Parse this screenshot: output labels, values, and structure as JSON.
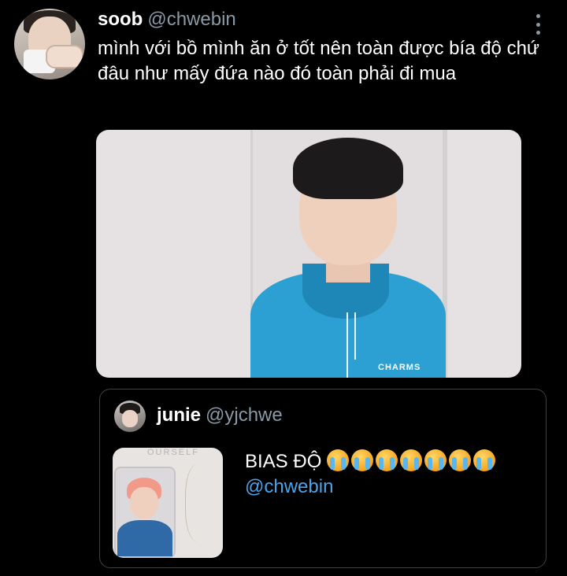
{
  "tweet": {
    "author_name": "soob",
    "author_handle": "@chwebin",
    "text": "mình với bồ mình ăn ở tốt nên toàn được bía độ chứ đâu như mấy đứa nào đó toàn phải đi mua",
    "photo_tag": "CHARMS"
  },
  "quote": {
    "author_name": "junie",
    "author_handle": "@yjchwe",
    "text": "BIAS ĐỘ",
    "emoji_count": 7,
    "emoji_name": "loudly-crying-face-emoji",
    "mention": "@chwebin",
    "thumb_text": "OURSELF"
  },
  "colors": {
    "background": "#000000",
    "text": "#ffffff",
    "secondary": "#8b98a5",
    "link": "#4da3ea",
    "border": "#3e4144"
  }
}
